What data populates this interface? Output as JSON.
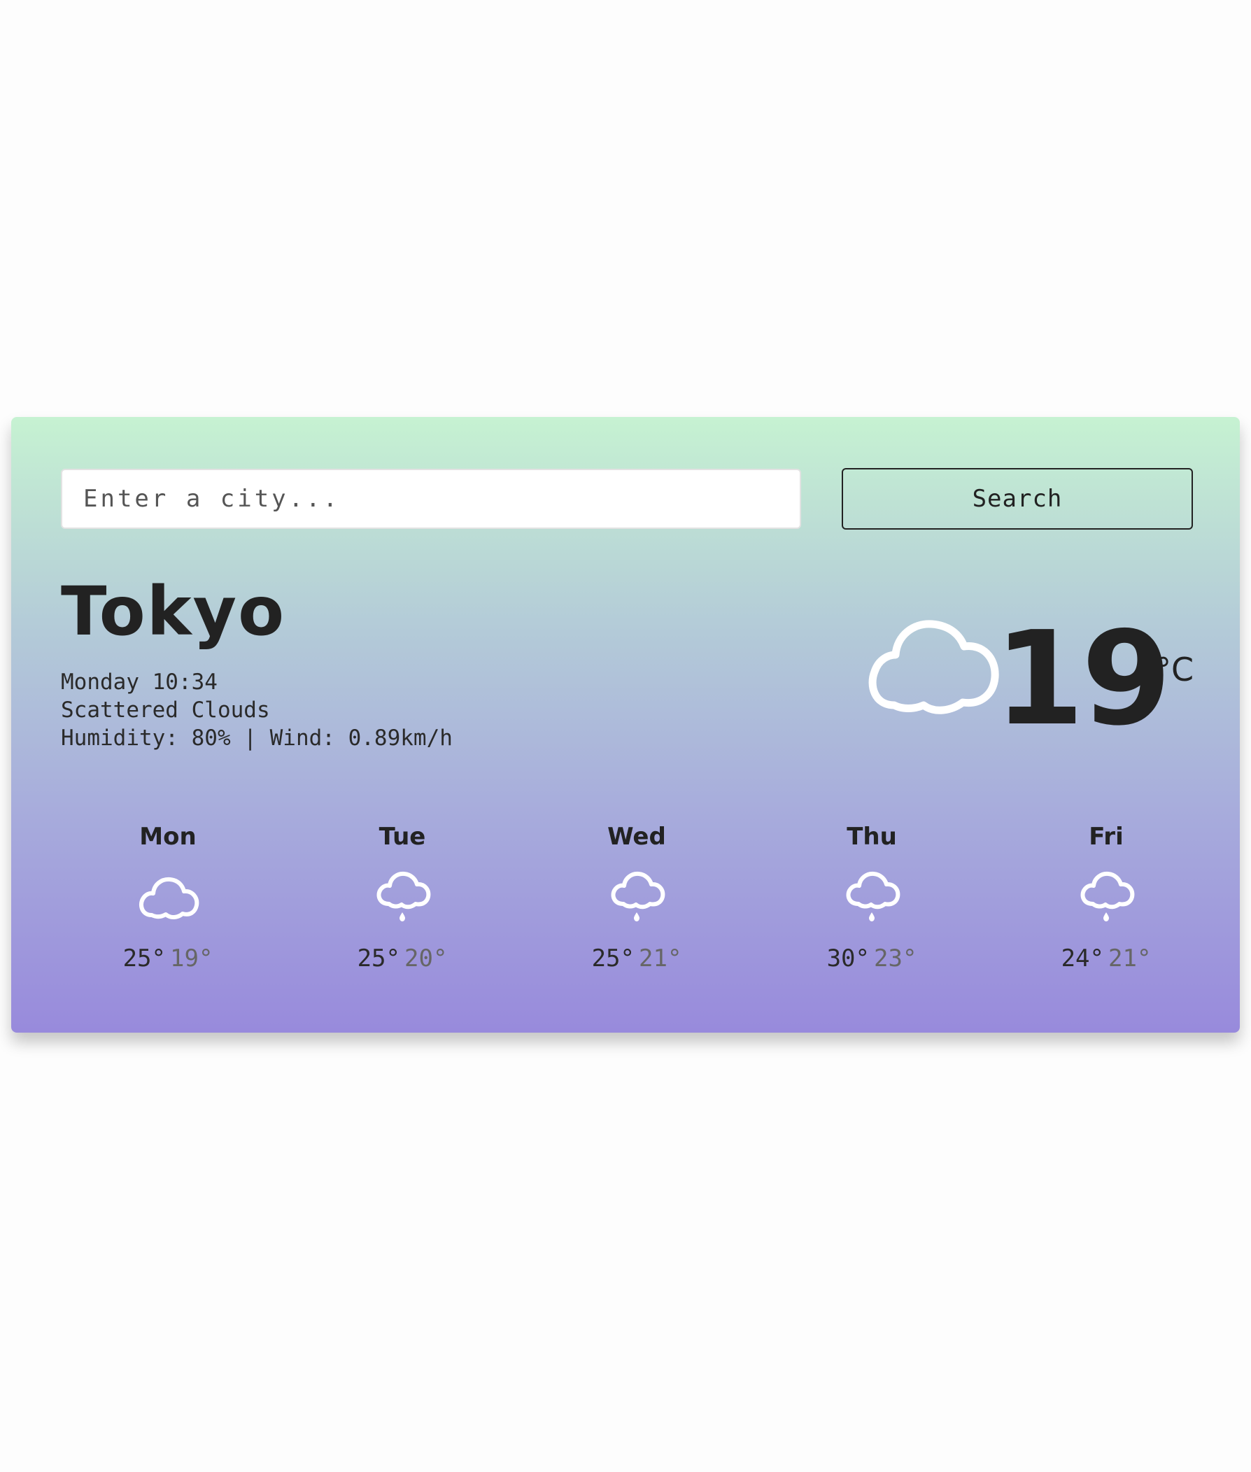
{
  "search": {
    "placeholder": "Enter a city...",
    "button_label": "Search"
  },
  "current": {
    "city": "Tokyo",
    "day_time": "Monday 10:34",
    "description": "Scattered Clouds",
    "humidity_wind": "Humidity: 80% | Wind: 0.89km/h",
    "temperature": "19",
    "unit": "°C",
    "icon": "cloud-icon"
  },
  "forecast": [
    {
      "day": "Mon",
      "max": "25°",
      "min": "19°",
      "icon": "cloud-icon"
    },
    {
      "day": "Tue",
      "max": "25°",
      "min": "20°",
      "icon": "rain-cloud-icon"
    },
    {
      "day": "Wed",
      "max": "25°",
      "min": "21°",
      "icon": "rain-cloud-icon"
    },
    {
      "day": "Thu",
      "max": "30°",
      "min": "23°",
      "icon": "rain-cloud-icon"
    },
    {
      "day": "Fri",
      "max": "24°",
      "min": "21°",
      "icon": "rain-cloud-icon"
    }
  ],
  "colors": {
    "gradient_top": "#c6f2d2",
    "gradient_bottom": "#988adc",
    "text": "#222222",
    "icon_stroke": "#ffffff"
  }
}
